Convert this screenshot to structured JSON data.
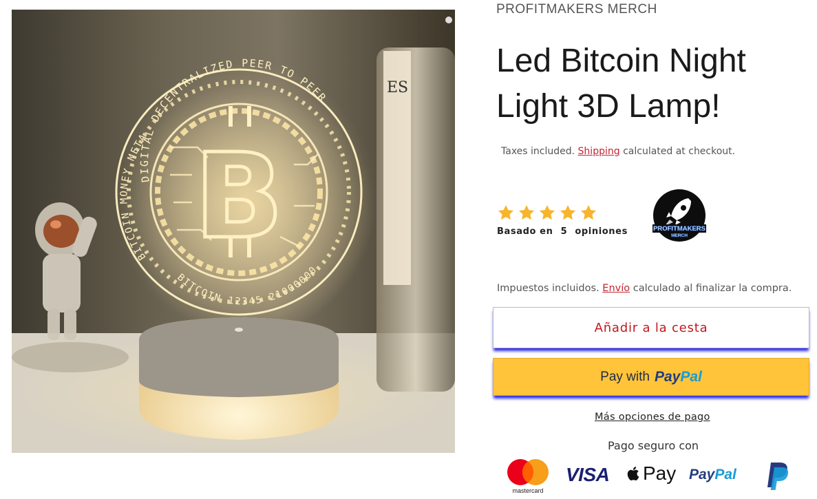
{
  "product": {
    "vendor": "PROFITMAKERS MERCH",
    "title": "Led Bitcoin Night Light 3D Lamp!",
    "tax_line_en": {
      "before": "Taxes included.",
      "link": "Shipping",
      "after": "calculated at checkout."
    },
    "rating": {
      "stars": 5,
      "max_stars": 5,
      "basado": "Basado en",
      "count": "5",
      "opiniones": "opiniones"
    },
    "brand_logo": {
      "line1": "PROFITMAKERS",
      "line2": "MERCH",
      "icon": "rocket-icon"
    },
    "tax_line_es": {
      "before": "Impuestos incluidos.",
      "link": "Envío",
      "after": "calculado al finalizar la compra."
    }
  },
  "image": {
    "coin_ring_text_top": "DIGITAL DECENTRALIZED PEER TO PEER",
    "coin_ring_text_left": "BITCOIN MONEY METALS",
    "coin_ring_text_bottom": "BITCOIN 12345 21000000",
    "coin_symbol": "B"
  },
  "actions": {
    "add_to_cart": "Añadir a la cesta",
    "paypal_pay_with": "Pay with",
    "paypal_pay": "Pay",
    "paypal_pal": "Pal",
    "more_payment_options": "Más opciones de pago"
  },
  "secure_payment": {
    "label": "Pago seguro con",
    "methods": {
      "mastercard": "mastercard",
      "visa": "VISA",
      "applepay": "Pay",
      "paypal_pay": "Pay",
      "paypal_pal": "Pal"
    }
  },
  "colors": {
    "link_red": "#c22531",
    "cart_text": "#c2161d",
    "paypal_yellow": "#ffc439",
    "focus_shadow": "#2d2ce6",
    "star_yellow": "#f7b52b"
  }
}
